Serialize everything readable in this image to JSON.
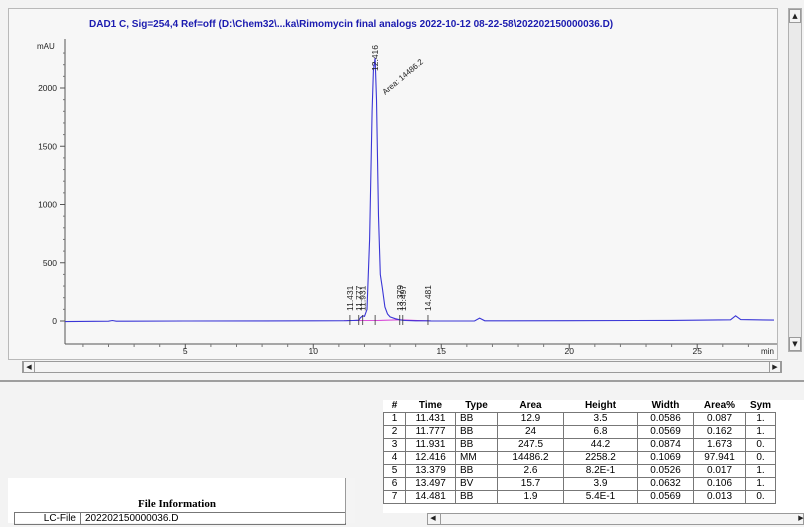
{
  "chart": {
    "title": "DAD1 C, Sig=254,4 Ref=off (D:\\Chem32\\...ka\\Rimomycin final analogs 2022-10-12 08-22-58\\202202150000036.D)",
    "y_unit": "mAU",
    "x_unit": "min",
    "y_ticks": [
      "500",
      "1000",
      "1500",
      "2000",
      "0"
    ],
    "x_ticks": [
      "5",
      "10",
      "15",
      "20",
      "25"
    ],
    "peak_labels": [
      "11.431",
      "11.777",
      "11.931",
      "12.416",
      "13.379",
      "13.497",
      "14.481"
    ],
    "area_label": "Area: 14486.2"
  },
  "chart_data": {
    "type": "line",
    "title": "DAD1 C, Sig=254,4 Ref=off (D:\\Chem32\\...ka\\Rimomycin final analogs 2022-10-12 08-22-58\\202202150000036.D)",
    "xlabel": "min",
    "ylabel": "mAU",
    "xlim": [
      0.3,
      28.0
    ],
    "ylim": [
      -80,
      2380
    ],
    "series": [
      {
        "x": [
          0.3,
          2.0,
          2.15,
          2.3,
          5,
          8,
          10,
          11.3,
          11.431,
          11.55,
          11.7,
          11.777,
          11.85,
          11.931,
          12.0,
          12.1,
          12.2,
          12.3,
          12.35,
          12.416,
          12.47,
          12.55,
          12.62,
          12.7,
          12.8,
          12.9,
          13.0,
          13.2,
          13.379,
          13.45,
          13.497,
          13.6,
          14.0,
          14.481,
          14.6,
          16.3,
          16.5,
          16.7,
          20,
          24,
          26.3,
          26.5,
          26.7,
          28.0
        ],
        "y": [
          -5,
          -2,
          4,
          -2,
          0,
          1,
          2,
          3,
          3.5,
          4,
          6,
          6.8,
          30,
          44,
          40,
          100,
          700,
          1800,
          2150,
          2258,
          1900,
          900,
          400,
          280,
          120,
          60,
          35,
          20,
          10,
          8,
          6,
          4,
          2,
          2,
          1,
          0,
          25,
          2,
          3,
          5,
          10,
          45,
          12,
          8
        ]
      }
    ]
  },
  "table": {
    "headers": [
      "#",
      "Time",
      "Type",
      "Area",
      "Height",
      "Width",
      "Area%",
      "Sym"
    ],
    "rows": [
      [
        "1",
        "11.431",
        "BB",
        "12.9",
        "3.5",
        "0.0586",
        "0.087",
        "1."
      ],
      [
        "2",
        "11.777",
        "BB",
        "24",
        "6.8",
        "0.0569",
        "0.162",
        "1."
      ],
      [
        "3",
        "11.931",
        "BB",
        "247.5",
        "44.2",
        "0.0874",
        "1.673",
        "0."
      ],
      [
        "4",
        "12.416",
        "MM",
        "14486.2",
        "2258.2",
        "0.1069",
        "97.941",
        "0."
      ],
      [
        "5",
        "13.379",
        "BB",
        "2.6",
        "8.2E-1",
        "0.0526",
        "0.017",
        "1."
      ],
      [
        "6",
        "13.497",
        "BV",
        "15.7",
        "3.9",
        "0.0632",
        "0.106",
        "1."
      ],
      [
        "7",
        "14.481",
        "BB",
        "1.9",
        "5.4E-1",
        "0.0569",
        "0.013",
        "0."
      ]
    ]
  },
  "file_info": {
    "title": "File Information",
    "key": "LC-File",
    "value": "202202150000036.D"
  },
  "colors": {
    "trace": "#3a36d6",
    "baseline": "#d020d0",
    "title": "#1b1bb0"
  }
}
